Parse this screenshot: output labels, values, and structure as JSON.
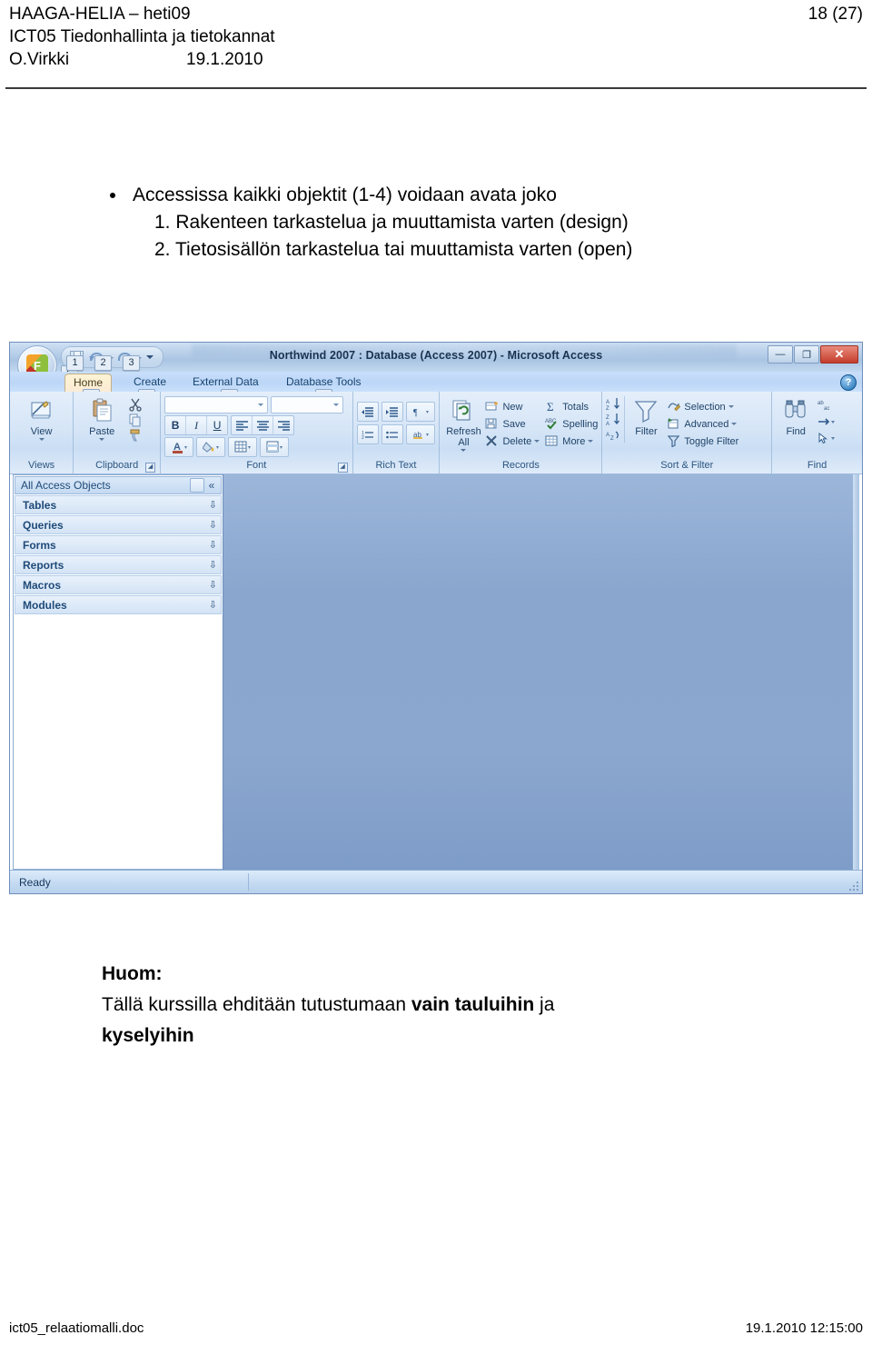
{
  "document_header": {
    "line1": "HAAGA-HELIA – heti09",
    "line2": "ICT05 Tiedonhallinta ja tietokannat",
    "author": "O.Virkki",
    "date": "19.1.2010",
    "page_number": "18 (27)"
  },
  "bullets": [
    {
      "level": 1,
      "text": "Accessissa kaikki objektit  (1-4) voidaan avata joko"
    },
    {
      "level": 2,
      "text": "1. Rakenteen tarkastelua ja muuttamista varten (design)"
    },
    {
      "level": 2,
      "text": "2. Tietosisällön tarkastelua tai muuttamista varten (open)"
    }
  ],
  "access_window": {
    "title": "Northwind 2007 : Database (Access 2007) - Microsoft Access",
    "office_button": {
      "glyph": "F",
      "keytip": "F"
    },
    "window_controls": {
      "minimize": "—",
      "restore": "❐",
      "close": "✕"
    },
    "help_button": "?",
    "quick_access_toolbar": [
      {
        "name": "save",
        "keytip": "1"
      },
      {
        "name": "undo",
        "keytip": "2"
      },
      {
        "name": "redo",
        "keytip": "3"
      }
    ],
    "tabs": [
      {
        "label": "Home",
        "keytip": "H",
        "active": true
      },
      {
        "label": "Create",
        "keytip": "C",
        "active": false
      },
      {
        "label": "External Data",
        "keytip": "X",
        "active": false
      },
      {
        "label": "Database Tools",
        "keytip": "A",
        "active": false
      }
    ],
    "ribbon_groups": [
      {
        "label": "Views",
        "has_launcher": false,
        "big_buttons": [
          {
            "label": "View",
            "icon": "design-view-icon",
            "has_dropdown": true
          }
        ],
        "small_items": []
      },
      {
        "label": "Clipboard",
        "has_launcher": true,
        "big_buttons": [
          {
            "label": "Paste",
            "icon": "paste-icon",
            "has_dropdown": true
          }
        ],
        "small_items": [
          {
            "label": "",
            "icon": "cut-icon"
          },
          {
            "label": "",
            "icon": "copy-icon"
          },
          {
            "label": "",
            "icon": "format-painter-icon"
          }
        ]
      },
      {
        "label": "Font",
        "has_launcher": true,
        "combos": [
          {
            "name": "font-name",
            "value": ""
          },
          {
            "name": "font-size",
            "value": ""
          }
        ],
        "buttons": [
          "B",
          "I",
          "U",
          "align-left",
          "align-center",
          "align-right",
          "font-color",
          "fill-color",
          "gridlines",
          "alternate-fill"
        ]
      },
      {
        "label": "Rich Text",
        "has_launcher": false,
        "buttons": [
          "decrease-indent",
          "increase-indent",
          "text-direction",
          "numbered-list",
          "bulleted-list",
          "text-highlight"
        ]
      },
      {
        "label": "Records",
        "has_launcher": false,
        "big_buttons": [
          {
            "label": "Refresh\nAll",
            "icon": "refresh-all-icon",
            "has_dropdown": true
          }
        ],
        "small_items": [
          {
            "label": "New",
            "icon": "new-record-icon"
          },
          {
            "label": "Save",
            "icon": "save-record-icon"
          },
          {
            "label": "Delete",
            "icon": "delete-record-icon",
            "has_dropdown": true
          },
          {
            "label": "Totals",
            "icon": "sigma-icon"
          },
          {
            "label": "Spelling",
            "icon": "spelling-icon"
          },
          {
            "label": "More",
            "icon": "more-icon",
            "has_dropdown": true
          }
        ]
      },
      {
        "label": "Sort & Filter",
        "has_launcher": false,
        "sort_buttons": [
          "sort-ascending",
          "sort-descending",
          "clear-sort"
        ],
        "big_buttons": [
          {
            "label": "Filter",
            "icon": "filter-funnel-icon",
            "has_dropdown": false
          }
        ],
        "small_items": [
          {
            "label": "Selection",
            "icon": "selection-icon",
            "has_dropdown": true
          },
          {
            "label": "Advanced",
            "icon": "advanced-icon",
            "has_dropdown": true
          },
          {
            "label": "Toggle Filter",
            "icon": "toggle-filter-icon"
          }
        ]
      },
      {
        "label": "Find",
        "has_launcher": false,
        "big_buttons": [
          {
            "label": "Find",
            "icon": "binoculars-icon",
            "has_dropdown": false
          }
        ],
        "small_items": [
          {
            "label": "",
            "icon": "replace-icon"
          },
          {
            "label": "",
            "icon": "goto-icon",
            "has_dropdown": true
          },
          {
            "label": "",
            "icon": "select-icon",
            "has_dropdown": true
          }
        ]
      }
    ],
    "navigation_pane": {
      "header": "All Access Objects",
      "collapse_glyph": "«",
      "items": [
        {
          "label": "Tables"
        },
        {
          "label": "Queries"
        },
        {
          "label": "Forms"
        },
        {
          "label": "Reports"
        },
        {
          "label": "Macros"
        },
        {
          "label": "Modules"
        }
      ]
    },
    "status_bar": {
      "text": "Ready"
    }
  },
  "note": {
    "heading": "Huom:",
    "line_prefix": "Tällä kurssilla ehditään tutustumaan ",
    "line_bold": "vain tauluihin",
    "line_suffix": " ja",
    "line2_bold": "kyselyihin"
  },
  "footer": {
    "filename": "ict05_relaatiomalli.doc",
    "timestamp": "19.1.2010 12:15:00"
  },
  "colors": {
    "ribbon_light": "#D5E5F7",
    "tab_strip": "#C9DFFB",
    "workarea_blue": "#8AA6CE",
    "nav_header": "#C4DAF1",
    "accent_text": "#1F4A78",
    "close_red": "#C43D2C"
  }
}
